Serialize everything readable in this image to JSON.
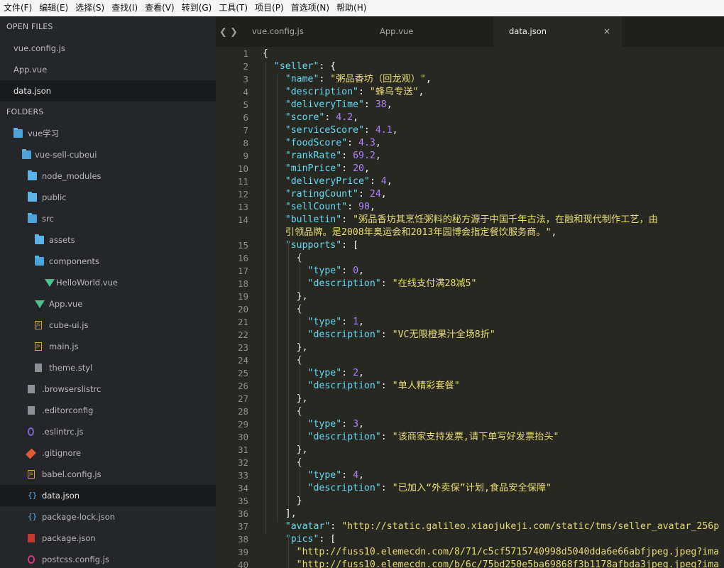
{
  "menu": [
    "文件(F)",
    "编辑(E)",
    "选择(S)",
    "查找(I)",
    "查看(V)",
    "转到(G)",
    "工具(T)",
    "项目(P)",
    "首选项(N)",
    "帮助(H)"
  ],
  "sidebar": {
    "open_files_title": "OPEN FILES",
    "open_files": [
      "vue.config.js",
      "App.vue",
      "data.json"
    ],
    "folders_title": "FOLDERS",
    "tree": [
      {
        "label": "vue学习",
        "icon": "folder-open-icon",
        "depth": 0
      },
      {
        "label": "vue-sell-cubeui",
        "icon": "folder-open-icon",
        "depth": 1
      },
      {
        "label": "node_modules",
        "icon": "folder-icon",
        "depth": 2
      },
      {
        "label": "public",
        "icon": "folder-icon",
        "depth": 2
      },
      {
        "label": "src",
        "icon": "folder-open-icon",
        "depth": 2
      },
      {
        "label": "assets",
        "icon": "folder-icon",
        "depth": 3
      },
      {
        "label": "components",
        "icon": "folder-open-icon",
        "depth": 3
      },
      {
        "label": "HelloWorld.vue",
        "icon": "vue-file-icon",
        "depth": 4
      },
      {
        "label": "App.vue",
        "icon": "vue-file-icon",
        "depth": 3
      },
      {
        "label": "cube-ui.js",
        "icon": "js-file-icon",
        "depth": 3
      },
      {
        "label": "main.js",
        "icon": "js-file-icon",
        "depth": 3
      },
      {
        "label": "theme.styl",
        "icon": "file-icon",
        "depth": 3
      },
      {
        "label": ".browserslistrc",
        "icon": "file-icon",
        "depth": 2
      },
      {
        "label": ".editorconfig",
        "icon": "file-icon",
        "depth": 2
      },
      {
        "label": ".eslintrc.js",
        "icon": "eslint-file-icon",
        "depth": 2
      },
      {
        "label": ".gitignore",
        "icon": "git-file-icon",
        "depth": 2
      },
      {
        "label": "babel.config.js",
        "icon": "js-file-icon",
        "depth": 2
      },
      {
        "label": "data.json",
        "icon": "json-file-icon",
        "depth": 2,
        "active": true
      },
      {
        "label": "package-lock.json",
        "icon": "json-file-icon",
        "depth": 2
      },
      {
        "label": "package.json",
        "icon": "npm-file-icon",
        "depth": 2
      },
      {
        "label": "postcss.config.js",
        "icon": "postcss-file-icon",
        "depth": 2
      }
    ]
  },
  "tabs": [
    {
      "label": "vue.config.js",
      "active": false
    },
    {
      "label": "App.vue",
      "active": false
    },
    {
      "label": "data.json",
      "active": true
    }
  ],
  "tab_close_glyph": "×",
  "editor": {
    "lines": [
      {
        "n": "1",
        "code": "{"
      },
      {
        "n": "2",
        "code": "  \"seller\": {"
      },
      {
        "n": "3",
        "code": "    \"name\": \"粥品香坊（回龙观）\","
      },
      {
        "n": "4",
        "code": "    \"description\": \"蜂鸟专送\","
      },
      {
        "n": "5",
        "code": "    \"deliveryTime\": 38,"
      },
      {
        "n": "6",
        "code": "    \"score\": 4.2,"
      },
      {
        "n": "7",
        "code": "    \"serviceScore\": 4.1,"
      },
      {
        "n": "8",
        "code": "    \"foodScore\": 4.3,"
      },
      {
        "n": "9",
        "code": "    \"rankRate\": 69.2,"
      },
      {
        "n": "10",
        "code": "    \"minPrice\": 20,"
      },
      {
        "n": "11",
        "code": "    \"deliveryPrice\": 4,"
      },
      {
        "n": "12",
        "code": "    \"ratingCount\": 24,"
      },
      {
        "n": "13",
        "code": "    \"sellCount\": 90,"
      },
      {
        "n": "14",
        "code": "    \"bulletin\": \"粥品香坊其烹饪粥料的秘方源于中国千年古法，在融和现代制作工艺，由"
      },
      {
        "n": "",
        "code": "    引领品牌。是2008年奥运会和2013年园博会指定餐饮服务商。\","
      },
      {
        "n": "15",
        "code": "    \"supports\": ["
      },
      {
        "n": "16",
        "code": "      {"
      },
      {
        "n": "17",
        "code": "        \"type\": 0,"
      },
      {
        "n": "18",
        "code": "        \"description\": \"在线支付满28减5\""
      },
      {
        "n": "19",
        "code": "      },"
      },
      {
        "n": "20",
        "code": "      {"
      },
      {
        "n": "21",
        "code": "        \"type\": 1,"
      },
      {
        "n": "22",
        "code": "        \"description\": \"VC无限橙果汁全场8折\""
      },
      {
        "n": "23",
        "code": "      },"
      },
      {
        "n": "24",
        "code": "      {"
      },
      {
        "n": "25",
        "code": "        \"type\": 2,"
      },
      {
        "n": "26",
        "code": "        \"description\": \"单人精彩套餐\""
      },
      {
        "n": "27",
        "code": "      },"
      },
      {
        "n": "28",
        "code": "      {"
      },
      {
        "n": "29",
        "code": "        \"type\": 3,"
      },
      {
        "n": "30",
        "code": "        \"description\": \"该商家支持发票,请下单写好发票抬头\""
      },
      {
        "n": "31",
        "code": "      },"
      },
      {
        "n": "32",
        "code": "      {"
      },
      {
        "n": "33",
        "code": "        \"type\": 4,"
      },
      {
        "n": "34",
        "code": "        \"description\": \"已加入“外卖保”计划,食品安全保障\""
      },
      {
        "n": "35",
        "code": "      }"
      },
      {
        "n": "36",
        "code": "    ],"
      },
      {
        "n": "37",
        "code": "    \"avatar\": \"http://static.galileo.xiaojukeji.com/static/tms/seller_avatar_256p"
      },
      {
        "n": "38",
        "code": "    \"pics\": ["
      },
      {
        "n": "39",
        "code": "      \"http://fuss10.elemecdn.com/8/71/c5cf5715740998d5040dda6e66abfjpeg.jpeg?ima"
      },
      {
        "n": "40",
        "code": "      \"http://fuss10.elemecdn.com/b/6c/75bd250e5ba69868f3b1178afbda3jpeg.jpeg?ima"
      }
    ]
  },
  "colors": {
    "editor_bg": "#272822",
    "sidebar_bg": "#25262a",
    "key": "#66d9ef",
    "string": "#e6db74",
    "number": "#ae81ff",
    "punct": "#f8f8f2"
  }
}
